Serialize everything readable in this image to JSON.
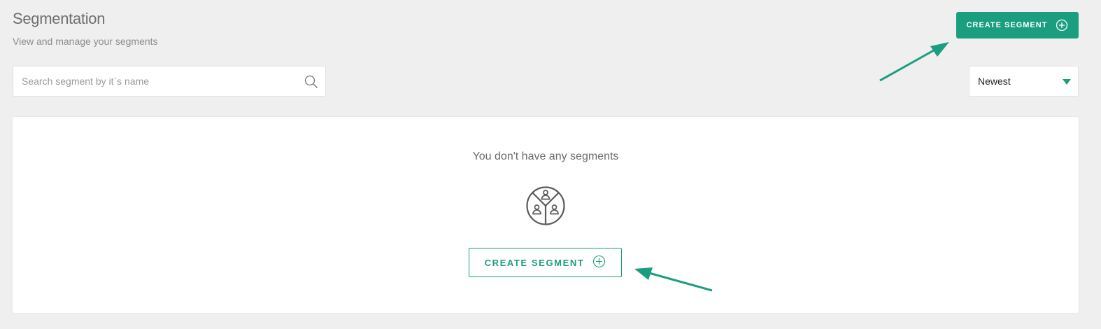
{
  "header": {
    "title": "Segmentation",
    "subtitle": "View and manage your segments",
    "create_button_label": "CREATE SEGMENT"
  },
  "search": {
    "placeholder": "Search segment by it`s name",
    "value": ""
  },
  "sort": {
    "selected": "Newest"
  },
  "empty_state": {
    "message": "You don't have any segments",
    "create_button_label": "CREATE SEGMENT",
    "icon": "segments-icon"
  },
  "colors": {
    "accent": "#1a9e7f",
    "background": "#efefef",
    "panel": "#ffffff"
  }
}
